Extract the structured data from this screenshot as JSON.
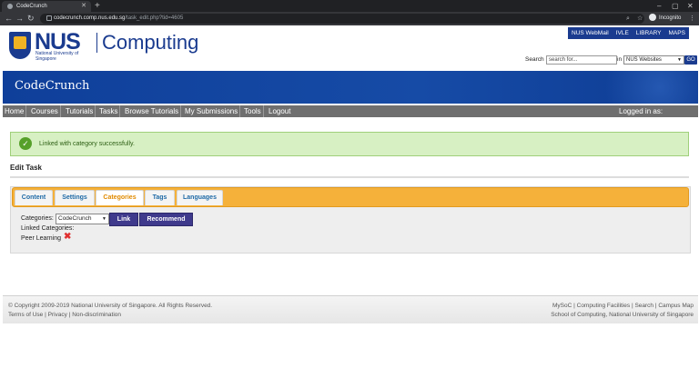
{
  "browser": {
    "tab_title": "CodeCrunch",
    "url_host": "codecrunch.comp.nus.edu.sg",
    "url_path": "/task_edit.php?tid=4605",
    "incognito_label": "Incognito"
  },
  "header": {
    "logo_text": "NUS",
    "logo_sub": "National University of Singapore",
    "dept": "Computing",
    "top_links": [
      "NUS WebMail",
      "IVLE",
      "LIBRARY",
      "MAPS"
    ],
    "search_label": "Search",
    "search_placeholder": "search for...",
    "search_in": "in",
    "search_scope": "NUS Websites",
    "go": "GO"
  },
  "banner": {
    "title": "CodeCrunch"
  },
  "nav": {
    "items": [
      "Home",
      "Courses",
      "Tutorials",
      "Tasks",
      "Browse Tutorials",
      "My Submissions",
      "Tools",
      "Logout"
    ],
    "logged_in": "Logged in as:"
  },
  "message": {
    "text": "Linked with category successfully."
  },
  "page_title": "Edit Task",
  "tabs": [
    "Content",
    "Settings",
    "Categories",
    "Tags",
    "Languages"
  ],
  "categories": {
    "label": "Categories:",
    "selected": "CodeCrunch",
    "link_btn": "Link",
    "recommend_btn": "Recommend",
    "linked_label": "Linked Categories:",
    "linked_item": "Peer Learning"
  },
  "footer": {
    "copyright": "© Copyright 2009-2019 National University of Singapore. All Rights Reserved.",
    "left_links": "Terms of Use | Privacy | Non-discrimination",
    "right_links": "MySoC | Computing Facilities | Search | Campus Map",
    "right_school": "School of Computing, National University of Singapore"
  },
  "colors": {
    "nus_blue": "#1a3b8f",
    "tab_orange": "#f5b13a",
    "success_bg": "#d7f0c3",
    "button": "#3f3a8c"
  }
}
